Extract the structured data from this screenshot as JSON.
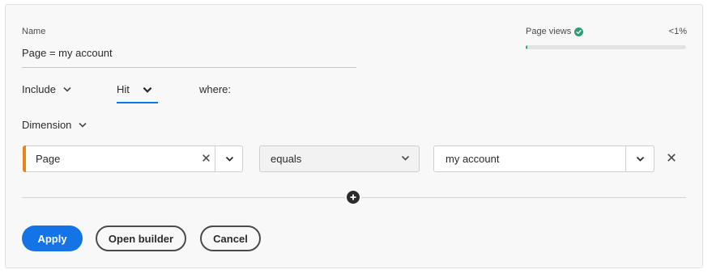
{
  "name": {
    "label": "Name",
    "value": "Page = my account"
  },
  "page_views": {
    "label": "Page views",
    "value": "<1%",
    "fill_fraction": 0.01,
    "color": "#2d9d78"
  },
  "scope": {
    "include_label": "Include",
    "hit_label": "Hit",
    "where_label": "where:"
  },
  "dimension": {
    "label": "Dimension"
  },
  "condition": {
    "dimension_value": "Page",
    "operator_value": "equals",
    "match_value": "my account"
  },
  "buttons": {
    "apply": "Apply",
    "open_builder": "Open builder",
    "cancel": "Cancel"
  },
  "colors": {
    "accent": "#1473e6",
    "dimension_marker": "#e68619",
    "success": "#2d9d78"
  }
}
